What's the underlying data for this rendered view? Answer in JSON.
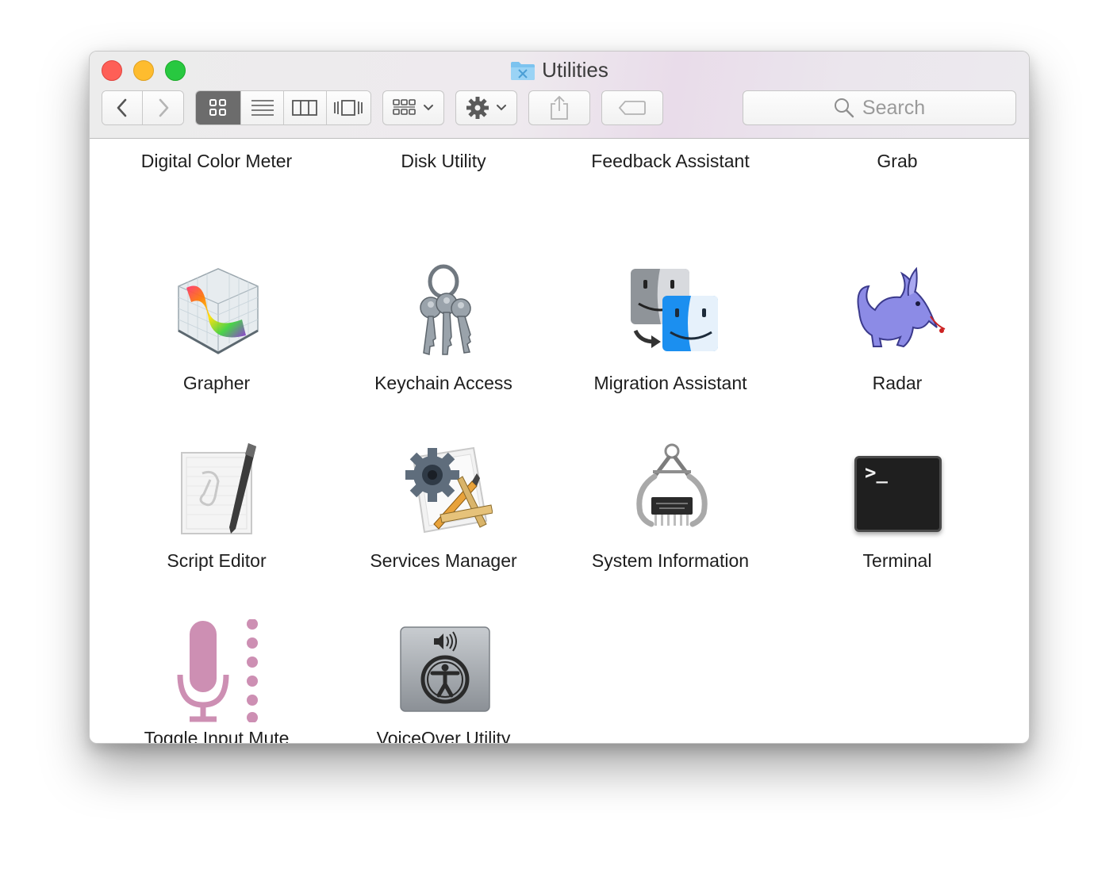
{
  "window": {
    "title": "Utilities",
    "traffic_lights": {
      "close_color": "#fe5f57",
      "minimize_color": "#febc2e",
      "zoom_color": "#28c840"
    }
  },
  "toolbar": {
    "back_icon": "chevron-left-icon",
    "forward_icon": "chevron-right-icon",
    "view_modes": [
      "icon-view",
      "list-view",
      "column-view",
      "cover-flow-view"
    ],
    "active_view": "icon-view",
    "arrange_icon": "arrange-grid-icon",
    "action_icon": "gear-icon",
    "share_icon": "share-icon",
    "tags_icon": "tag-icon",
    "search_placeholder": "Search"
  },
  "items": [
    {
      "label": "Digital Color Meter",
      "icon": "digital-color-meter-icon"
    },
    {
      "label": "Disk Utility",
      "icon": "disk-utility-icon"
    },
    {
      "label": "Feedback Assistant",
      "icon": "feedback-assistant-icon"
    },
    {
      "label": "Grab",
      "icon": "grab-icon"
    },
    {
      "label": "Grapher",
      "icon": "grapher-icon"
    },
    {
      "label": "Keychain Access",
      "icon": "keychain-access-icon"
    },
    {
      "label": "Migration Assistant",
      "icon": "migration-assistant-icon"
    },
    {
      "label": "Radar",
      "icon": "radar-icon"
    },
    {
      "label": "Script Editor",
      "icon": "script-editor-icon"
    },
    {
      "label": "Services Manager",
      "icon": "services-manager-icon"
    },
    {
      "label": "System Information",
      "icon": "system-information-icon"
    },
    {
      "label": "Terminal",
      "icon": "terminal-icon"
    },
    {
      "label": "Toggle Input Mute",
      "icon": "microphone-icon"
    },
    {
      "label": "VoiceOver Utility",
      "icon": "voiceover-utility-icon"
    }
  ],
  "terminal_prompt": ">_"
}
